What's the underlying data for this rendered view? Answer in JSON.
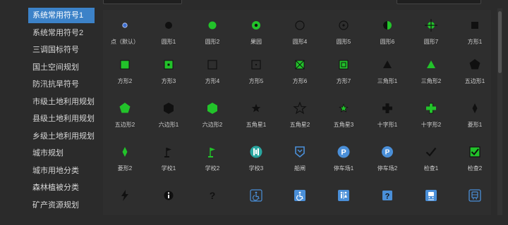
{
  "sidebar": {
    "items": [
      {
        "label": "系统常用符号1",
        "active": true
      },
      {
        "label": "系统常用符号2",
        "active": false
      },
      {
        "label": "三调国标符号",
        "active": false
      },
      {
        "label": "国土空间规划",
        "active": false
      },
      {
        "label": "防汛抗旱符号",
        "active": false
      },
      {
        "label": "市级土地利用规划",
        "active": false
      },
      {
        "label": "县级土地利用规划",
        "active": false
      },
      {
        "label": "乡级土地利用规划",
        "active": false
      },
      {
        "label": "城市规划",
        "active": false
      },
      {
        "label": "城市用地分类",
        "active": false
      },
      {
        "label": "森林植被分类",
        "active": false
      },
      {
        "label": "矿产资源规划",
        "active": false
      }
    ]
  },
  "symbols": [
    {
      "label": "点（默认）",
      "icon": "default-point"
    },
    {
      "label": "圆形1",
      "icon": "circle-black"
    },
    {
      "label": "圆形2",
      "icon": "circle-green"
    },
    {
      "label": "果园",
      "icon": "orchard-circle"
    },
    {
      "label": "圆形4",
      "icon": "circle-outline"
    },
    {
      "label": "圆形5",
      "icon": "circle-dot"
    },
    {
      "label": "圆形6",
      "icon": "circle-half"
    },
    {
      "label": "圆形7",
      "icon": "circle-cross"
    },
    {
      "label": "方形1",
      "icon": "square-black"
    },
    {
      "label": "方形2",
      "icon": "square-green"
    },
    {
      "label": "方形3",
      "icon": "square-green-dot"
    },
    {
      "label": "方形4",
      "icon": "square-outline"
    },
    {
      "label": "方形5",
      "icon": "square-dot"
    },
    {
      "label": "方形6",
      "icon": "square-x"
    },
    {
      "label": "方形7",
      "icon": "square-nested"
    },
    {
      "label": "三角形1",
      "icon": "triangle-black"
    },
    {
      "label": "三角形2",
      "icon": "triangle-green"
    },
    {
      "label": "五边形1",
      "icon": "pentagon-black"
    },
    {
      "label": "五边形2",
      "icon": "pentagon-green"
    },
    {
      "label": "六边形1",
      "icon": "hexagon-black"
    },
    {
      "label": "六边形2",
      "icon": "hexagon-green"
    },
    {
      "label": "五角星1",
      "icon": "star-black"
    },
    {
      "label": "五角星2",
      "icon": "star-outline"
    },
    {
      "label": "五角星3",
      "icon": "star-green"
    },
    {
      "label": "十字形1",
      "icon": "cross-black"
    },
    {
      "label": "十字形2",
      "icon": "cross-green"
    },
    {
      "label": "菱形1",
      "icon": "diamond-black"
    },
    {
      "label": "菱形2",
      "icon": "diamond-green"
    },
    {
      "label": "学校1",
      "icon": "flag-black"
    },
    {
      "label": "学校2",
      "icon": "flag-green"
    },
    {
      "label": "学校3",
      "icon": "school-teal"
    },
    {
      "label": "船闸",
      "icon": "shield-blue"
    },
    {
      "label": "停车场1",
      "icon": "parking-circle"
    },
    {
      "label": "停车场2",
      "icon": "parking-circle-2"
    },
    {
      "label": "检查1",
      "icon": "check-black"
    },
    {
      "label": "检查2",
      "icon": "check-green-box"
    },
    {
      "label": "",
      "icon": "lightning"
    },
    {
      "label": "",
      "icon": "info-circle"
    },
    {
      "label": "",
      "icon": "question"
    },
    {
      "label": "",
      "icon": "accessible"
    },
    {
      "label": "",
      "icon": "accessible-2"
    },
    {
      "label": "",
      "icon": "restroom"
    },
    {
      "label": "",
      "icon": "question-box"
    },
    {
      "label": "",
      "icon": "train"
    },
    {
      "label": "",
      "icon": "bus"
    }
  ]
}
